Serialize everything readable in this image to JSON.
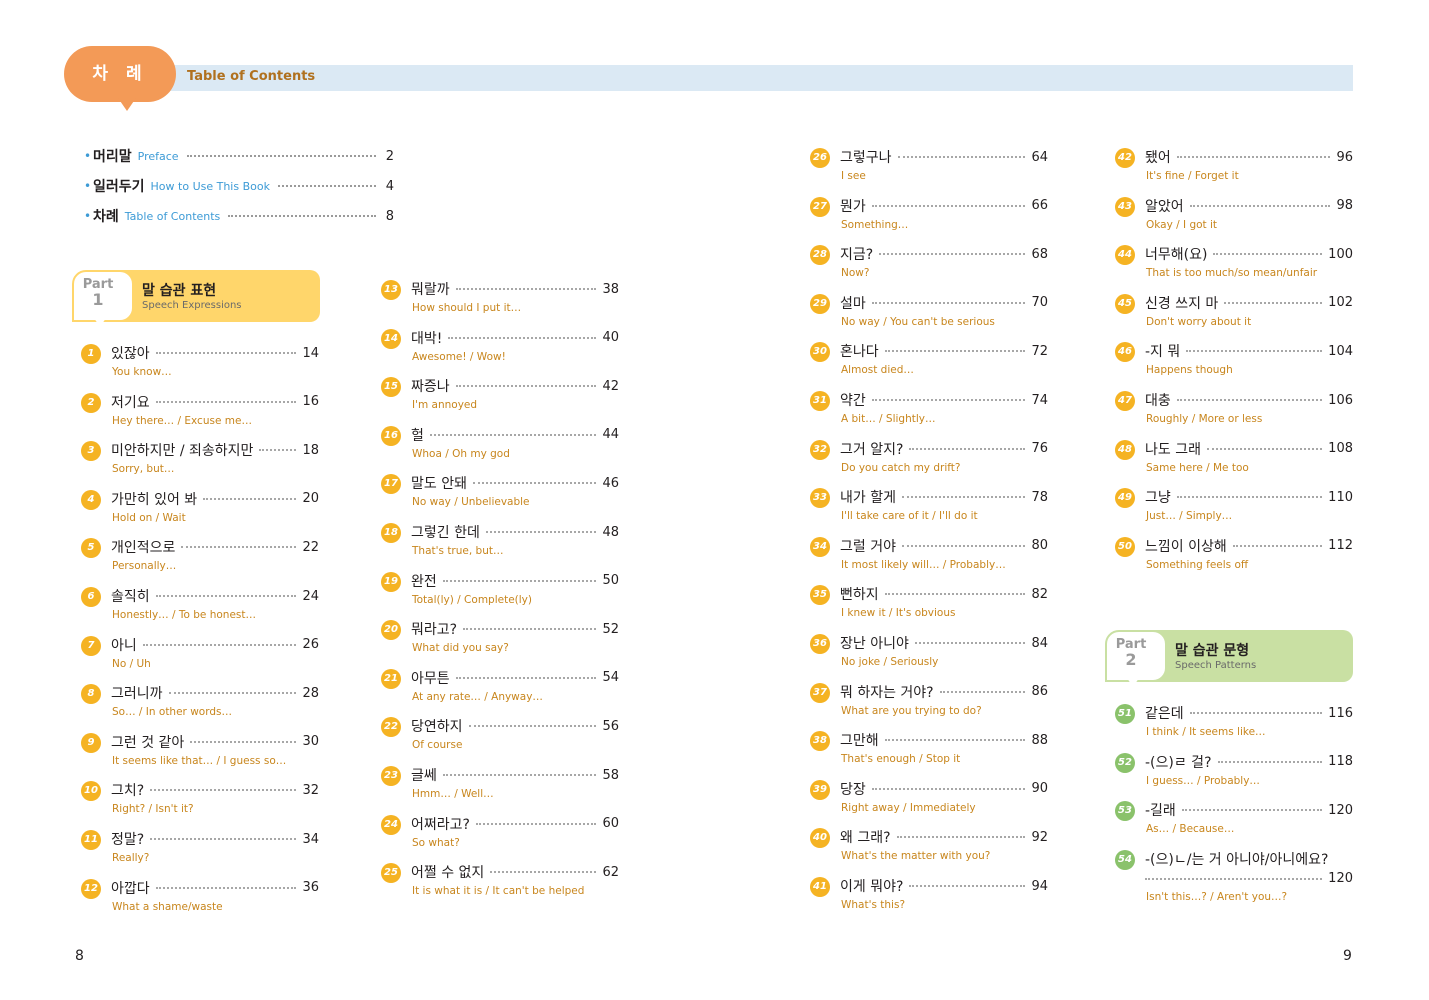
{
  "header": {
    "label": "차 례",
    "title": "Table of Contents"
  },
  "front_matter": [
    {
      "ko": "머리말",
      "en": "Preface",
      "page": "2"
    },
    {
      "ko": "일러두기",
      "en": "How to Use This Book",
      "page": "4"
    },
    {
      "ko": "차례",
      "en": "Table of Contents",
      "page": "8"
    }
  ],
  "part1": {
    "word": "Part",
    "number": "1",
    "ko": "말 습관 표현",
    "en": "Speech Expressions"
  },
  "part2": {
    "word": "Part",
    "number": "2",
    "ko": "말 습관 문형",
    "en": "Speech Patterns"
  },
  "entries": [
    {
      "n": "1",
      "ko": "있잖아",
      "en": "You know…",
      "page": "14"
    },
    {
      "n": "2",
      "ko": "저기요",
      "en": "Hey there… / Excuse me…",
      "page": "16"
    },
    {
      "n": "3",
      "ko": "미안하지만 / 죄송하지만",
      "en": "Sorry, but…",
      "page": "18"
    },
    {
      "n": "4",
      "ko": "가만히 있어 봐",
      "en": "Hold on / Wait",
      "page": "20"
    },
    {
      "n": "5",
      "ko": "개인적으로",
      "en": "Personally…",
      "page": "22"
    },
    {
      "n": "6",
      "ko": "솔직히",
      "en": "Honestly… / To be honest…",
      "page": "24"
    },
    {
      "n": "7",
      "ko": "아니",
      "en": "No / Uh",
      "page": "26"
    },
    {
      "n": "8",
      "ko": "그러니까",
      "en": "So… / In other words…",
      "page": "28"
    },
    {
      "n": "9",
      "ko": "그런 것 같아",
      "en": "It seems like that… / I guess so…",
      "page": "30"
    },
    {
      "n": "10",
      "ko": "그치?",
      "en": "Right? / Isn't it?",
      "page": "32"
    },
    {
      "n": "11",
      "ko": "정말?",
      "en": "Really?",
      "page": "34"
    },
    {
      "n": "12",
      "ko": "아깝다",
      "en": "What a shame/waste",
      "page": "36"
    },
    {
      "n": "13",
      "ko": "뭐랄까",
      "en": "How should I put it…",
      "page": "38"
    },
    {
      "n": "14",
      "ko": "대박!",
      "en": "Awesome! / Wow!",
      "page": "40"
    },
    {
      "n": "15",
      "ko": "짜증나",
      "en": "I'm annoyed",
      "page": "42"
    },
    {
      "n": "16",
      "ko": "헐",
      "en": "Whoa / Oh my god",
      "page": "44"
    },
    {
      "n": "17",
      "ko": "말도 안돼",
      "en": "No way / Unbelievable",
      "page": "46"
    },
    {
      "n": "18",
      "ko": "그렇긴 한데",
      "en": "That's true, but…",
      "page": "48"
    },
    {
      "n": "19",
      "ko": "완전",
      "en": "Total(ly) / Complete(ly)",
      "page": "50"
    },
    {
      "n": "20",
      "ko": "뭐라고?",
      "en": "What did you say?",
      "page": "52"
    },
    {
      "n": "21",
      "ko": "아무튼",
      "en": "At any rate… / Anyway…",
      "page": "54"
    },
    {
      "n": "22",
      "ko": "당연하지",
      "en": "Of course",
      "page": "56"
    },
    {
      "n": "23",
      "ko": "글쎄",
      "en": "Hmm… / Well…",
      "page": "58"
    },
    {
      "n": "24",
      "ko": "어쩌라고?",
      "en": "So what?",
      "page": "60"
    },
    {
      "n": "25",
      "ko": "어쩔 수 없지",
      "en": "It is what it is / It can't be helped",
      "page": "62"
    },
    {
      "n": "26",
      "ko": "그렇구나",
      "en": "I see",
      "page": "64"
    },
    {
      "n": "27",
      "ko": "뭔가",
      "en": "Something…",
      "page": "66"
    },
    {
      "n": "28",
      "ko": "지금?",
      "en": "Now?",
      "page": "68"
    },
    {
      "n": "29",
      "ko": "설마",
      "en": "No way / You can't be serious",
      "page": "70"
    },
    {
      "n": "30",
      "ko": "혼나다",
      "en": "Almost died…",
      "page": "72"
    },
    {
      "n": "31",
      "ko": "약간",
      "en": "A bit… / Slightly…",
      "page": "74"
    },
    {
      "n": "32",
      "ko": "그거 알지?",
      "en": "Do you catch my drift?",
      "page": "76"
    },
    {
      "n": "33",
      "ko": "내가 할게",
      "en": "I'll take care of it / I'll do it",
      "page": "78"
    },
    {
      "n": "34",
      "ko": "그럴 거야",
      "en": "It most likely will… / Probably…",
      "page": "80"
    },
    {
      "n": "35",
      "ko": "뻔하지",
      "en": "I knew it / It's obvious",
      "page": "82"
    },
    {
      "n": "36",
      "ko": "장난 아니야",
      "en": "No joke / Seriously",
      "page": "84"
    },
    {
      "n": "37",
      "ko": "뭐 하자는 거야?",
      "en": "What are you trying to do?",
      "page": "86"
    },
    {
      "n": "38",
      "ko": "그만해",
      "en": "That's enough / Stop it",
      "page": "88"
    },
    {
      "n": "39",
      "ko": "당장",
      "en": "Right away / Immediately",
      "page": "90"
    },
    {
      "n": "40",
      "ko": "왜 그래?",
      "en": "What's the matter with you?",
      "page": "92"
    },
    {
      "n": "41",
      "ko": "이게 뭐야?",
      "en": "What's this?",
      "page": "94"
    },
    {
      "n": "42",
      "ko": "됐어",
      "en": "It's fine / Forget it",
      "page": "96"
    },
    {
      "n": "43",
      "ko": "알았어",
      "en": "Okay / I got it",
      "page": "98"
    },
    {
      "n": "44",
      "ko": "너무해(요)",
      "en": "That is too much/so mean/unfair",
      "page": "100"
    },
    {
      "n": "45",
      "ko": "신경 쓰지 마",
      "en": "Don't worry about it",
      "page": "102"
    },
    {
      "n": "46",
      "ko": "-지 뭐",
      "en": "Happens though",
      "page": "104"
    },
    {
      "n": "47",
      "ko": "대충",
      "en": "Roughly / More or less",
      "page": "106"
    },
    {
      "n": "48",
      "ko": "나도 그래",
      "en": "Same here / Me too",
      "page": "108"
    },
    {
      "n": "49",
      "ko": "그냥",
      "en": "Just… / Simply…",
      "page": "110"
    },
    {
      "n": "50",
      "ko": "느낌이 이상해",
      "en": "Something feels off",
      "page": "112"
    },
    {
      "n": "51",
      "ko": "같은데",
      "en": "I think / It seems like…",
      "page": "116"
    },
    {
      "n": "52",
      "ko": "-(으)ㄹ 걸?",
      "en": "I guess… / Probably…",
      "page": "118"
    },
    {
      "n": "53",
      "ko": "-길래",
      "en": "As… / Because…",
      "page": "120"
    },
    {
      "n": "54",
      "ko": "-(으)ㄴ/는 거 아니야/아니에요?",
      "en": "Isn't this…? / Aren't you…?",
      "page": "120"
    }
  ],
  "folio": {
    "left": "8",
    "right": "9"
  },
  "colors": {
    "header_bubble": "#f39a57",
    "header_band": "#dbe9f4",
    "part1_banner": "#ffd66b",
    "part2_banner": "#c9e0a3",
    "part1_number": "#f5b323",
    "part2_number": "#8ac26b",
    "english_text": "#c8861d",
    "front_english": "#3d9bd6"
  }
}
